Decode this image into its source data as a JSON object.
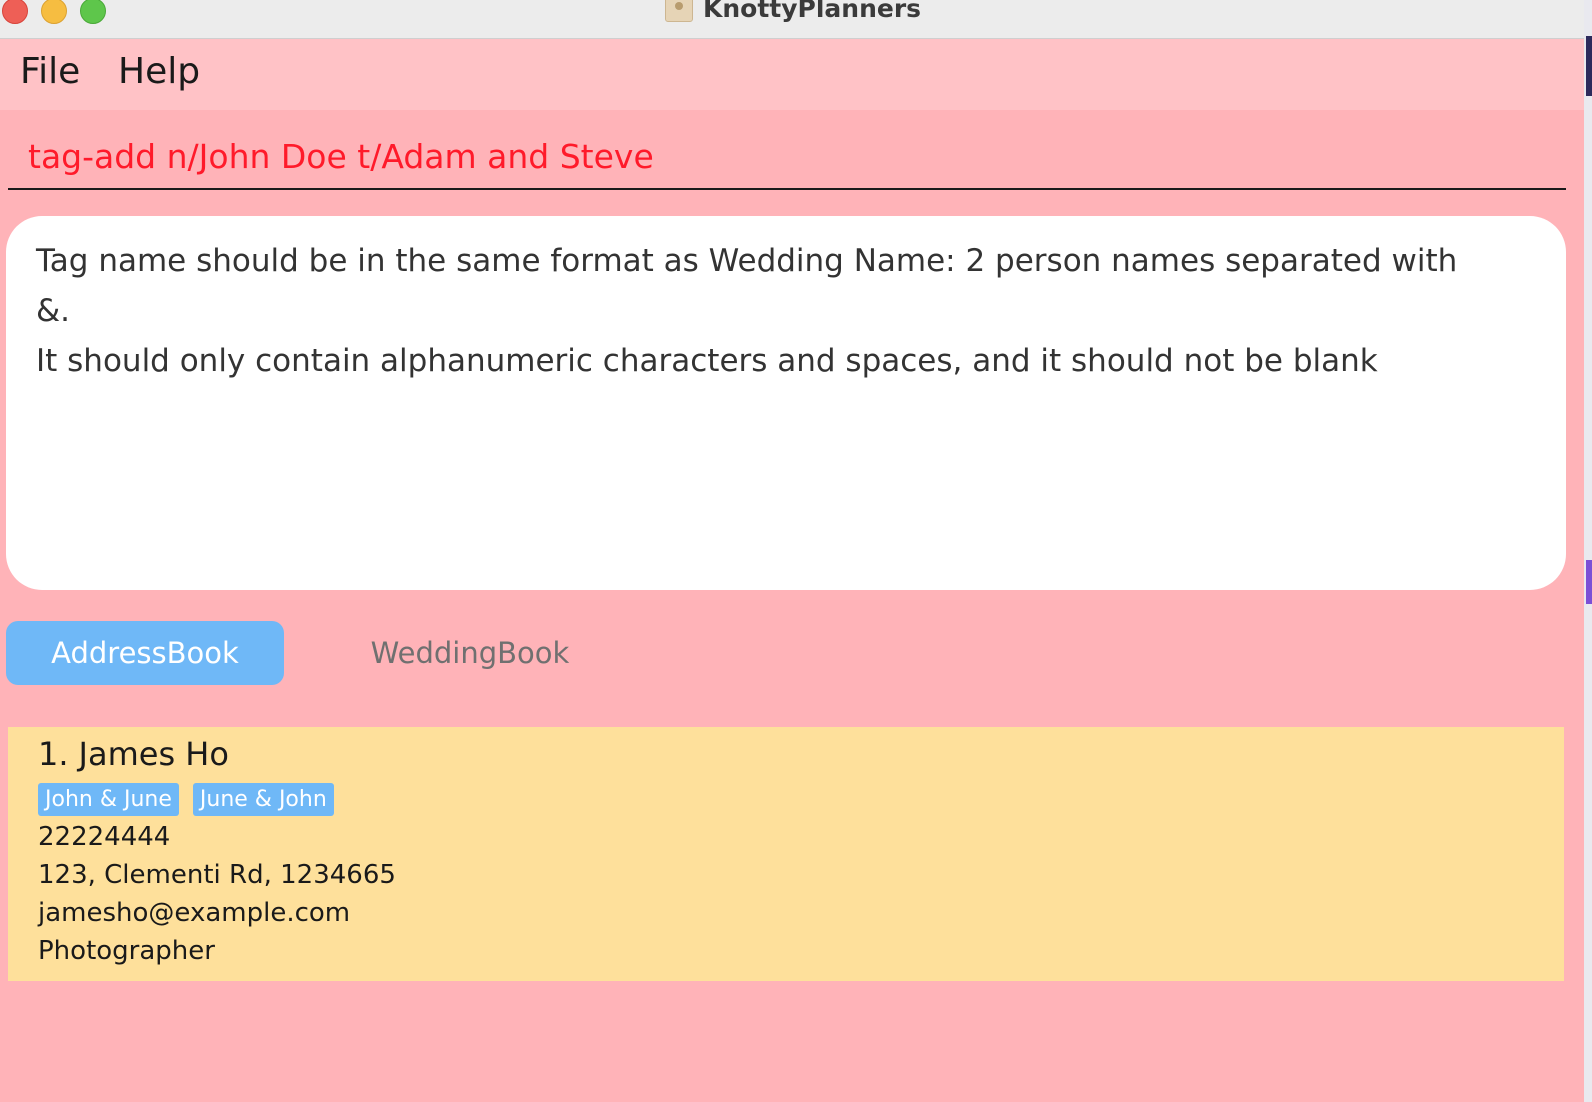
{
  "window": {
    "title": "KnottyPlanners"
  },
  "menu": {
    "file": "File",
    "help": "Help"
  },
  "command": {
    "value": "tag-add n/John Doe t/Adam and Steve"
  },
  "result": {
    "message": "Tag name should be in the same format as Wedding Name: 2 person names separated with\n&.\nIt should only contain alphanumeric characters and spaces, and it should not be blank"
  },
  "tabs": [
    {
      "label": "AddressBook",
      "active": true
    },
    {
      "label": "WeddingBook",
      "active": false
    }
  ],
  "persons": [
    {
      "index": "1.",
      "name": "James Ho",
      "tags": [
        "John & June",
        "June & John"
      ],
      "phone": "22224444",
      "address": "123, Clementi Rd, 1234665",
      "email": "jamesho@example.com",
      "role": "Photographer"
    }
  ],
  "colors": {
    "background": "#ffb3b8",
    "menubar": "#ffc2c6",
    "command_text": "#ff1a2a",
    "accent": "#6fb8f7",
    "card": "#fee09b"
  }
}
